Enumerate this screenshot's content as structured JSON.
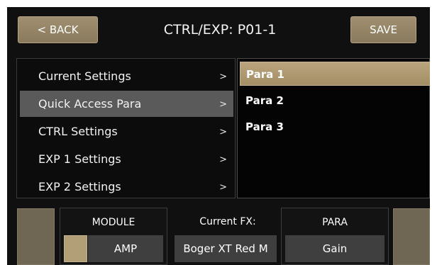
{
  "header": {
    "back_label": "< BACK",
    "title": "CTRL/EXP: P01-1",
    "save_label": "SAVE"
  },
  "menu": {
    "items": [
      {
        "label": "Current Settings",
        "chevron": ">"
      },
      {
        "label": "Quick Access Para",
        "chevron": ">",
        "selected": true
      },
      {
        "label": "CTRL Settings",
        "chevron": ">"
      },
      {
        "label": "EXP 1 Settings",
        "chevron": ">"
      },
      {
        "label": "EXP 2 Settings",
        "chevron": ">"
      }
    ]
  },
  "params": {
    "items": [
      {
        "label": "Para 1",
        "selected": true
      },
      {
        "label": "Para 2"
      },
      {
        "label": "Para 3"
      }
    ]
  },
  "bottom": {
    "module_label": "MODULE",
    "module_value": "AMP",
    "fx_label": "Current FX:",
    "fx_value": "Boger XT Red M",
    "para_label": "PARA",
    "para_value": "Gain"
  },
  "colors": {
    "accent": "#a38e66",
    "background": "#101010",
    "selection": "#5a5a5a"
  }
}
